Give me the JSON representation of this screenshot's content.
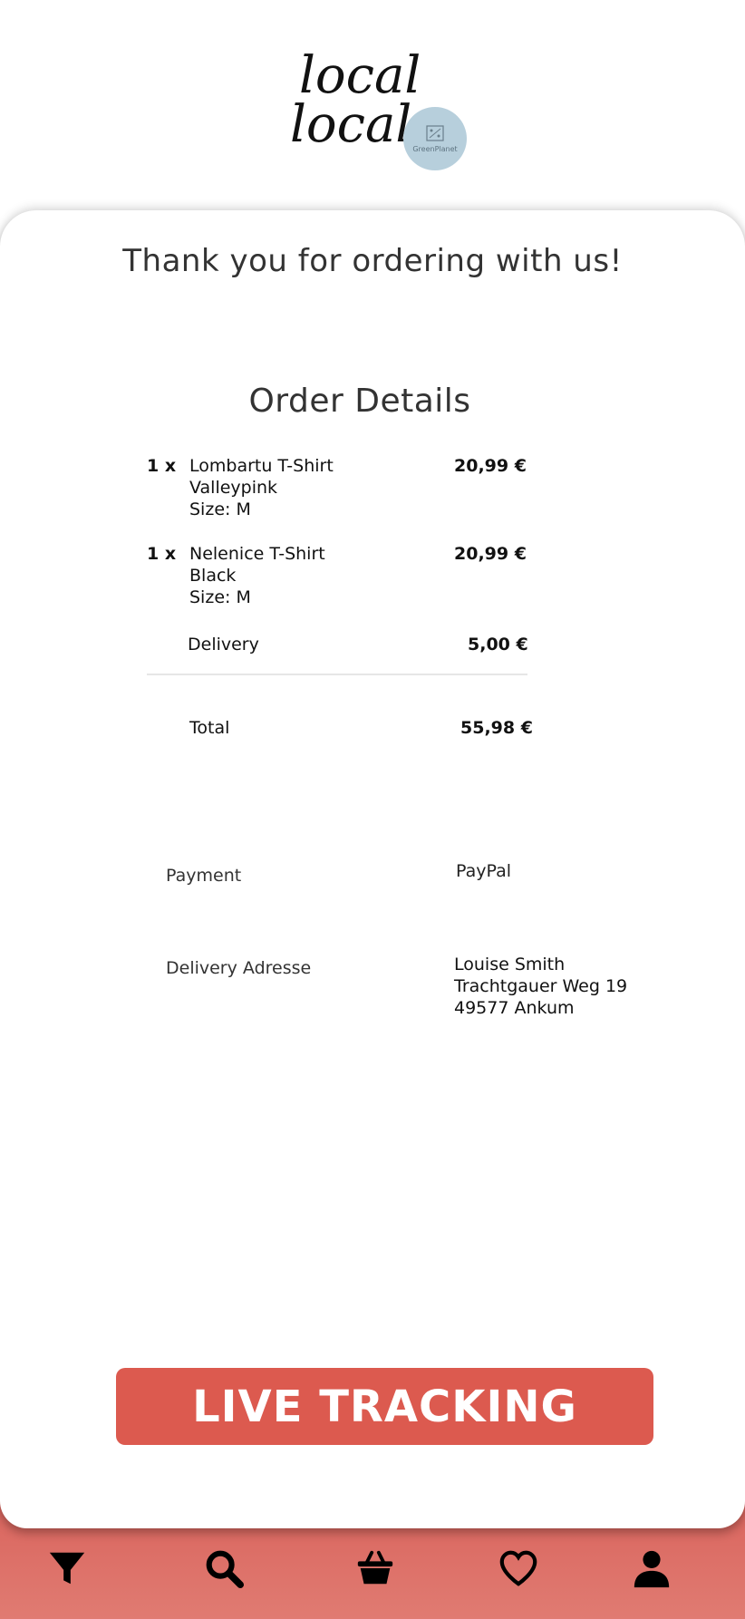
{
  "brand": {
    "logo_text_line1": "local",
    "logo_text_line2": "local",
    "badge_text": "GreenPlanet",
    "badge_color": "#b7cfdc"
  },
  "heading": "Thank you for ordering with us!",
  "order_details": {
    "title": "Order Details",
    "items": [
      {
        "qty": "1 x",
        "name": "Lombartu T-Shirt",
        "color": "Valleypink",
        "size": "Size: M",
        "price": "20,99 €"
      },
      {
        "qty": "1 x",
        "name": "Nelenice T-Shirt",
        "color": "Black",
        "size": "Size: M",
        "price": "20,99 €"
      }
    ],
    "delivery_label": "Delivery",
    "delivery_price": "5,00 €",
    "total_label": "Total",
    "total_price": "55,98 €"
  },
  "payment": {
    "label": "Payment",
    "value": "PayPal"
  },
  "address": {
    "label": "Delivery Adresse",
    "lines": [
      "Louise Smith",
      "Trachtgauer Weg 19",
      "49577 Ankum"
    ]
  },
  "cta": {
    "label": "LIVE TRACKING",
    "color": "#dc5a4f"
  },
  "nav": {
    "background": "#d85f58",
    "items": [
      {
        "icon": "filter-icon"
      },
      {
        "icon": "search-icon"
      },
      {
        "icon": "basket-icon"
      },
      {
        "icon": "heart-icon"
      },
      {
        "icon": "user-icon"
      }
    ]
  }
}
